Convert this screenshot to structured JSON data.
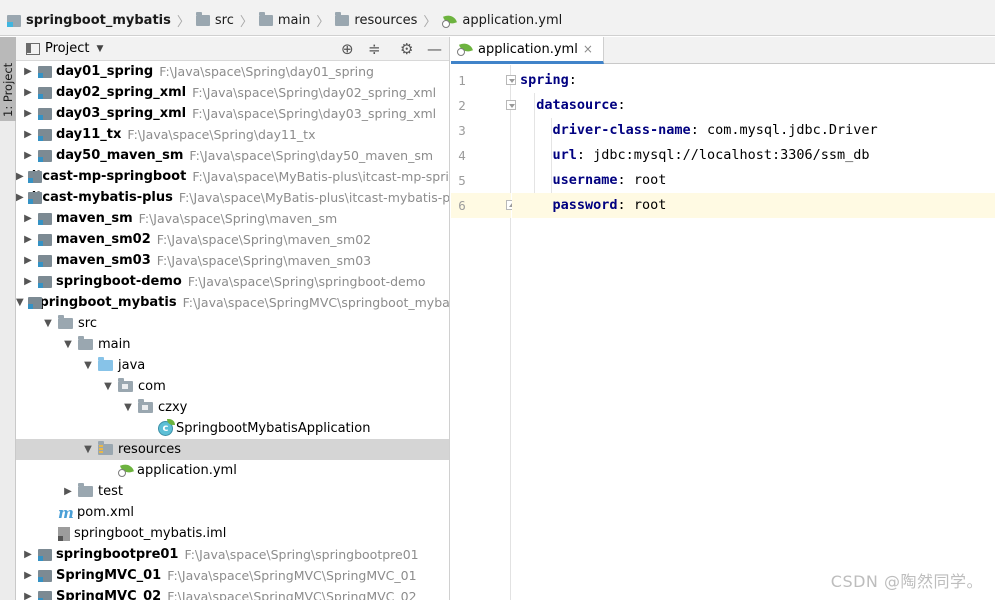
{
  "breadcrumb": [
    {
      "label": "springboot_mybatis",
      "icon": "module-icon",
      "bold": true
    },
    {
      "label": "src",
      "icon": "folder-icon"
    },
    {
      "label": "main",
      "icon": "folder-icon"
    },
    {
      "label": "resources",
      "icon": "resources-folder-icon"
    },
    {
      "label": "application.yml",
      "icon": "spring-yml-icon"
    }
  ],
  "stripe": {
    "tab_label": "1: Project"
  },
  "project_panel": {
    "title": "Project",
    "header_icons": [
      "locate-icon",
      "collapse-icon",
      "gear-icon",
      "minimize-icon"
    ],
    "tree": [
      {
        "level": 0,
        "arrow": "collapsed",
        "kind": "module",
        "name": "day01_spring",
        "path": "F:\\Java\\space\\Spring\\day01_spring"
      },
      {
        "level": 0,
        "arrow": "collapsed",
        "kind": "module",
        "name": "day02_spring_xml",
        "path": "F:\\Java\\space\\Spring\\day02_spring_xml"
      },
      {
        "level": 0,
        "arrow": "collapsed",
        "kind": "module",
        "name": "day03_spring_xml",
        "path": "F:\\Java\\space\\Spring\\day03_spring_xml"
      },
      {
        "level": 0,
        "arrow": "collapsed",
        "kind": "module",
        "name": "day11_tx",
        "path": "F:\\Java\\space\\Spring\\day11_tx"
      },
      {
        "level": 0,
        "arrow": "collapsed",
        "kind": "module",
        "name": "day50_maven_sm",
        "path": "F:\\Java\\space\\Spring\\day50_maven_sm"
      },
      {
        "level": 0,
        "arrow": "collapsed",
        "kind": "module",
        "name": "itcast-mp-springboot",
        "path": "F:\\Java\\space\\MyBatis-plus\\itcast-mp-springboot"
      },
      {
        "level": 0,
        "arrow": "collapsed",
        "kind": "module",
        "name": "itcast-mybatis-plus",
        "path": "F:\\Java\\space\\MyBatis-plus\\itcast-mybatis-plus"
      },
      {
        "level": 0,
        "arrow": "collapsed",
        "kind": "module",
        "name": "maven_sm",
        "path": "F:\\Java\\space\\Spring\\maven_sm"
      },
      {
        "level": 0,
        "arrow": "collapsed",
        "kind": "module",
        "name": "maven_sm02",
        "path": "F:\\Java\\space\\Spring\\maven_sm02"
      },
      {
        "level": 0,
        "arrow": "collapsed",
        "kind": "module",
        "name": "maven_sm03",
        "path": "F:\\Java\\space\\Spring\\maven_sm03"
      },
      {
        "level": 0,
        "arrow": "collapsed",
        "kind": "module",
        "name": "springboot-demo",
        "path": "F:\\Java\\space\\Spring\\springboot-demo"
      },
      {
        "level": 0,
        "arrow": "expanded",
        "kind": "module",
        "name": "springboot_mybatis",
        "path": "F:\\Java\\space\\SpringMVC\\springboot_mybatis"
      },
      {
        "level": 1,
        "arrow": "expanded",
        "kind": "folder",
        "name": "src",
        "path": ""
      },
      {
        "level": 2,
        "arrow": "expanded",
        "kind": "folder",
        "name": "main",
        "path": ""
      },
      {
        "level": 3,
        "arrow": "expanded",
        "kind": "source-folder",
        "name": "java",
        "path": ""
      },
      {
        "level": 4,
        "arrow": "expanded",
        "kind": "package",
        "name": "com",
        "path": ""
      },
      {
        "level": 5,
        "arrow": "expanded",
        "kind": "package",
        "name": "czxy",
        "path": ""
      },
      {
        "level": 6,
        "arrow": "none",
        "kind": "class",
        "name": "SpringbootMybatisApplication",
        "path": ""
      },
      {
        "level": 3,
        "arrow": "expanded",
        "kind": "resources",
        "name": "resources",
        "path": "",
        "selected": true
      },
      {
        "level": 4,
        "arrow": "none",
        "kind": "yml",
        "name": "application.yml",
        "path": ""
      },
      {
        "level": 2,
        "arrow": "collapsed",
        "kind": "folder",
        "name": "test",
        "path": ""
      },
      {
        "level": 1,
        "arrow": "none",
        "kind": "maven",
        "name": "pom.xml",
        "path": ""
      },
      {
        "level": 1,
        "arrow": "none",
        "kind": "iml",
        "name": "springboot_mybatis.iml",
        "path": ""
      },
      {
        "level": 0,
        "arrow": "collapsed",
        "kind": "module",
        "name": "springbootpre01",
        "path": "F:\\Java\\space\\Spring\\springbootpre01"
      },
      {
        "level": 0,
        "arrow": "collapsed",
        "kind": "module",
        "name": "SpringMVC_01",
        "path": "F:\\Java\\space\\SpringMVC\\SpringMVC_01"
      },
      {
        "level": 0,
        "arrow": "collapsed",
        "kind": "module",
        "name": "SpringMVC_02",
        "path": "F:\\Java\\space\\SpringMVC\\SpringMVC_02"
      }
    ]
  },
  "editor": {
    "tab": {
      "label": "application.yml",
      "close": "×"
    },
    "lines": [
      {
        "n": "1",
        "indent": 0,
        "key": "spring",
        "sep": ":",
        "value": ""
      },
      {
        "n": "2",
        "indent": 2,
        "key": "datasource",
        "sep": ":",
        "value": ""
      },
      {
        "n": "3",
        "indent": 4,
        "key": "driver-class-name",
        "sep": ": ",
        "value": "com.mysql.jdbc.Driver"
      },
      {
        "n": "4",
        "indent": 4,
        "key": "url",
        "sep": ": ",
        "value": "jdbc:mysql://localhost:3306/ssm_db"
      },
      {
        "n": "5",
        "indent": 4,
        "key": "username",
        "sep": ": ",
        "value": "root"
      },
      {
        "n": "6",
        "indent": 4,
        "key": "password",
        "sep": ": ",
        "value": "root",
        "current": true
      }
    ]
  },
  "watermark": "CSDN @陶然同学。",
  "colors": {
    "key": "#000080",
    "current_line": "#fffae3",
    "selected_row": "#d5d5d5",
    "tab_underline": "#4083c9"
  }
}
